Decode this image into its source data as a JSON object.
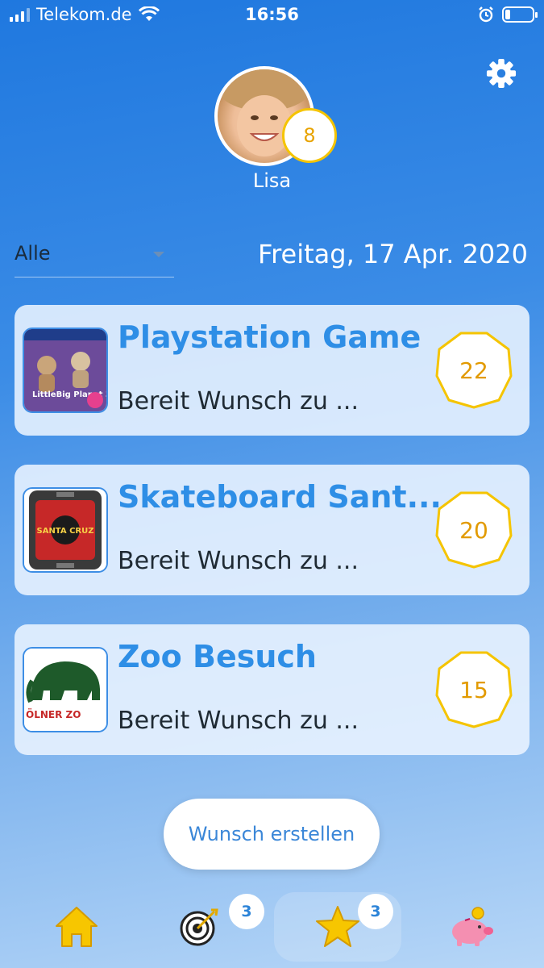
{
  "status_bar": {
    "carrier": "Telekom.de",
    "time": "16:56"
  },
  "profile": {
    "name": "Lisa",
    "level": "8"
  },
  "filter": {
    "selected": "Alle"
  },
  "date": "Freitag, 17 Apr. 2020",
  "wishes": [
    {
      "title": "Playstation Game",
      "status": "Bereit Wunsch zu ...",
      "points": "22",
      "thumb_text": "LittleBig Planet 3"
    },
    {
      "title": "Skateboard Sant...",
      "status": "Bereit Wunsch zu ...",
      "points": "20",
      "thumb_text": "SANTA CRUZ"
    },
    {
      "title": "Zoo Besuch",
      "status": "Bereit Wunsch zu ...",
      "points": "15",
      "thumb_text": "ÖLNER ZO"
    }
  ],
  "create_button": "Wunsch erstellen",
  "tabbar": {
    "tabs": [
      {
        "icon": "home-icon"
      },
      {
        "icon": "target-icon",
        "badge": "3"
      },
      {
        "icon": "star-icon",
        "badge": "3",
        "active": true
      },
      {
        "icon": "piggy-bank-icon"
      }
    ]
  },
  "colors": {
    "accent": "#2e8ee6",
    "points_gold": "#f5c400",
    "background_top": "#1f78df"
  }
}
